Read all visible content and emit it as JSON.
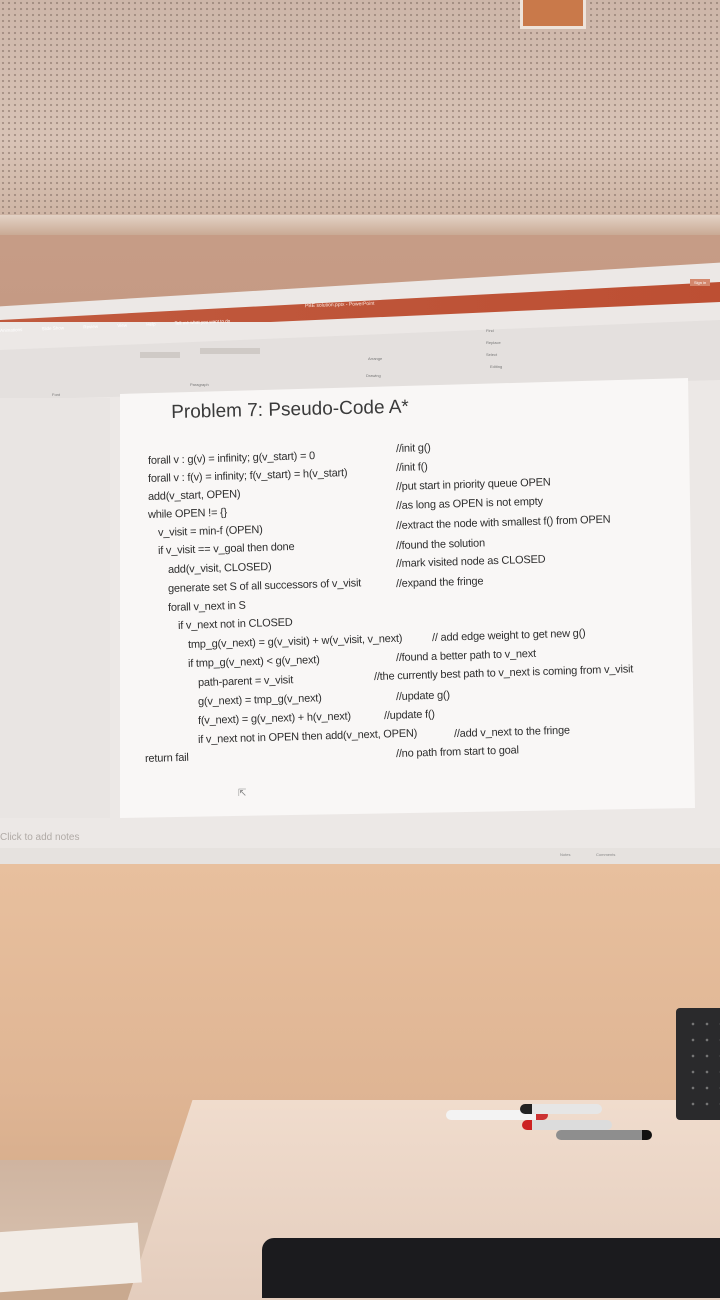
{
  "window": {
    "title": "PBE solution.pptx - PowerPoint",
    "sign_in": "Sign in",
    "tell_me": "Tell me what you want to do",
    "tabs": [
      "Animations",
      "Slide Show",
      "Review",
      "View",
      "Help"
    ]
  },
  "ribbon": {
    "groups": [
      "Font",
      "Paragraph",
      "Drawing",
      "Editing"
    ],
    "arrange": "Arrange",
    "find": "Find",
    "replace": "Replace",
    "select": "Select"
  },
  "slide": {
    "title": "Problem 7: Pseudo-Code A*",
    "lines": [
      {
        "code": "forall v : g(v) = infinity; g(v_start) = 0",
        "comment": "//init g()"
      },
      {
        "code": "forall v : f(v) = infinity; f(v_start) = h(v_start)",
        "comment": "//init f()"
      },
      {
        "code": "add(v_start, OPEN)",
        "comment": "//put start in priority queue OPEN"
      },
      {
        "code": "while OPEN != {}",
        "comment": "//as long as OPEN is not empty"
      },
      {
        "code": "v_visit = min-f (OPEN)",
        "comment": "//extract the node with smallest f() from OPEN"
      },
      {
        "code": "if v_visit == v_goal then done",
        "comment": "//found the solution"
      },
      {
        "code": "add(v_visit, CLOSED)",
        "comment": "//mark visited node as CLOSED"
      },
      {
        "code": "generate set S of all successors of v_visit",
        "comment": "//expand the fringe"
      },
      {
        "code": "forall v_next in S",
        "comment": ""
      },
      {
        "code": "if v_next not in CLOSED",
        "comment": ""
      },
      {
        "code": "tmp_g(v_next) = g(v_visit) + w(v_visit, v_next)",
        "comment": "// add edge weight to get new g()"
      },
      {
        "code": "if tmp_g(v_next) < g(v_next)",
        "comment": "//found a better path to v_next"
      },
      {
        "code": "path-parent = v_visit",
        "comment": "//the currently best path to v_next is coming from v_visit"
      },
      {
        "code": "g(v_next) = tmp_g(v_next)",
        "comment": "//update g()"
      },
      {
        "code": "f(v_next) = g(v_next) + h(v_next)",
        "comment": "//update f()"
      },
      {
        "code": "if v_next not in OPEN then add(v_next, OPEN)",
        "comment": "//add v_next to the fringe"
      },
      {
        "code": "return fail",
        "comment": "//no path from start to goal"
      }
    ]
  },
  "notes_placeholder": "Click to add notes",
  "status": {
    "notes": "Notes",
    "comments": "Comments"
  }
}
